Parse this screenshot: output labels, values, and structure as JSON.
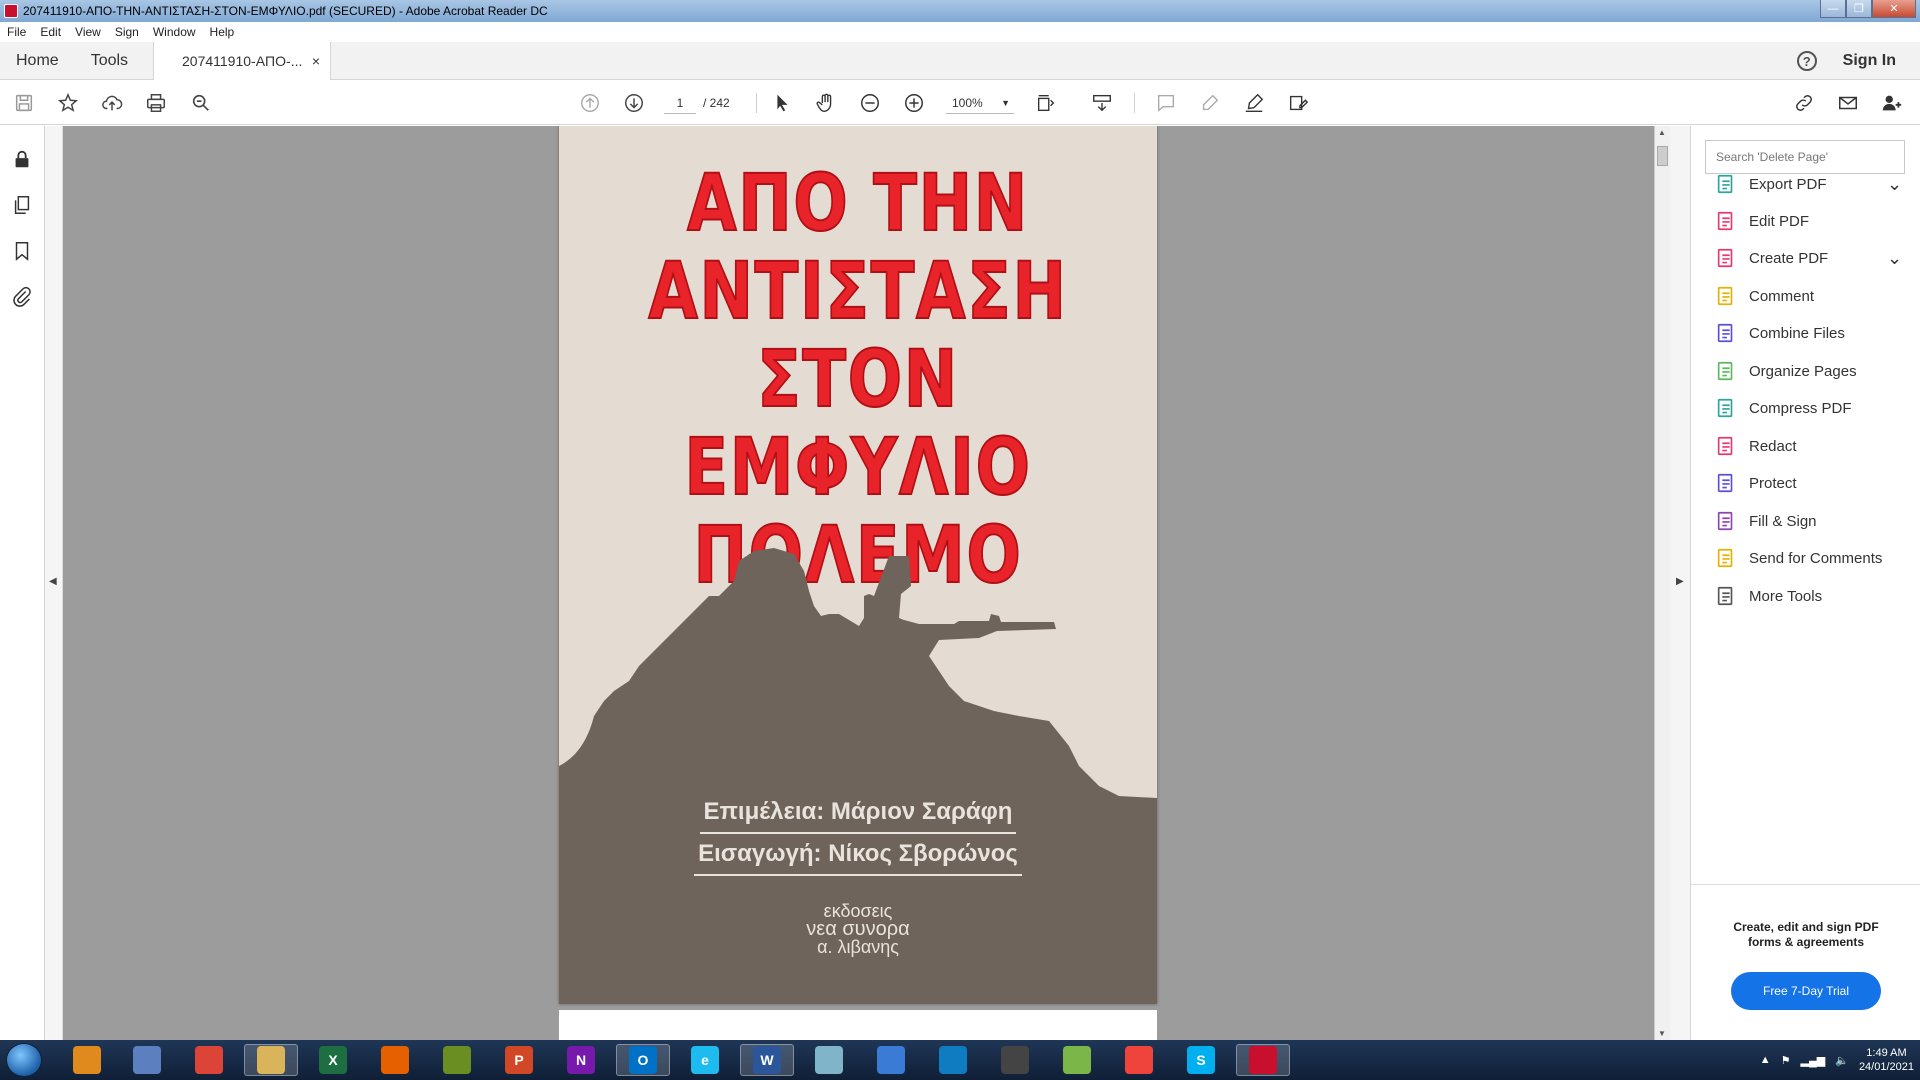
{
  "window": {
    "title": "207411910-ΑΠΟ-ΤΗΝ-ΑΝΤΙΣΤΑΣΗ-ΣΤΟΝ-ΕΜΦΥΛΙΟ.pdf (SECURED) - Adobe Acrobat Reader DC",
    "minimize": "—",
    "maximize": "❐",
    "close": "✕"
  },
  "menubar": [
    "File",
    "Edit",
    "View",
    "Sign",
    "Window",
    "Help"
  ],
  "tabs": {
    "home": "Home",
    "tools": "Tools",
    "document": "207411910-ΑΠΟ-...",
    "close": "×",
    "help": "?",
    "sign_in": "Sign In"
  },
  "toolbar": {
    "current_page": "1",
    "page_count": "/ 242",
    "zoom": "100%"
  },
  "document": {
    "cover_title": [
      "ΑΠΟ ΤΗΝ",
      "ΑΝΤΙΣΤΑΣΗ",
      "ΣΤΟΝ ΕΜΦΥΛΙΟ",
      "ΠΟΛΕΜΟ"
    ],
    "editor": "Επιμέλεια: Μάριον Σαράφη",
    "introduction": "Εισαγωγή: Νίκος Σβορώνος",
    "publisher": [
      "εκδοσεις",
      "νεα συνορα",
      "α. λιβανης"
    ],
    "cover_colors": {
      "title": "#e8232a",
      "silhouette": "#6e645b",
      "paper": "#e4dcd2"
    }
  },
  "right_pane": {
    "search_placeholder": "Search 'Delete Page'",
    "tools": [
      {
        "label": "Export PDF",
        "icon": "export-pdf-icon",
        "color": "#2aa39b",
        "expand": true
      },
      {
        "label": "Edit PDF",
        "icon": "edit-pdf-icon",
        "color": "#e5396e",
        "expand": false
      },
      {
        "label": "Create PDF",
        "icon": "create-pdf-icon",
        "color": "#e5396e",
        "expand": true
      },
      {
        "label": "Comment",
        "icon": "comment-icon",
        "color": "#e6b100",
        "expand": false
      },
      {
        "label": "Combine Files",
        "icon": "combine-files-icon",
        "color": "#5b4fd9",
        "expand": false
      },
      {
        "label": "Organize Pages",
        "icon": "organize-pages-icon",
        "color": "#5cb85c",
        "expand": false
      },
      {
        "label": "Compress PDF",
        "icon": "compress-pdf-icon",
        "color": "#2aa39b",
        "expand": false
      },
      {
        "label": "Redact",
        "icon": "redact-icon",
        "color": "#e5396e",
        "expand": false
      },
      {
        "label": "Protect",
        "icon": "protect-icon",
        "color": "#5b4fd9",
        "expand": false
      },
      {
        "label": "Fill & Sign",
        "icon": "fill-sign-icon",
        "color": "#8e44ad",
        "expand": false
      },
      {
        "label": "Send for Comments",
        "icon": "send-for-comments-icon",
        "color": "#e6b100",
        "expand": false
      },
      {
        "label": "More Tools",
        "icon": "more-tools-icon",
        "color": "#555555",
        "expand": false
      }
    ],
    "promo": "Create, edit and sign PDF forms & agreements",
    "trial_button": "Free 7-Day Trial",
    "accent": "#1473e6"
  },
  "taskbar": {
    "apps": [
      {
        "name": "media-player",
        "label": "",
        "color": "#e08a1e"
      },
      {
        "name": "photo-app",
        "label": "",
        "color": "#5b7fbf"
      },
      {
        "name": "chrome",
        "label": "",
        "color": "#db4437"
      },
      {
        "name": "file-explorer",
        "label": "",
        "color": "#d9b45a"
      },
      {
        "name": "excel",
        "label": "X",
        "color": "#1d6f42"
      },
      {
        "name": "firefox",
        "label": "",
        "color": "#e66000"
      },
      {
        "name": "paint",
        "label": "",
        "color": "#6b8e23"
      },
      {
        "name": "powerpoint",
        "label": "P",
        "color": "#d24726"
      },
      {
        "name": "onenote",
        "label": "N",
        "color": "#7719aa"
      },
      {
        "name": "outlook",
        "label": "O",
        "color": "#0072c6"
      },
      {
        "name": "internet-explorer",
        "label": "e",
        "color": "#1ebbee"
      },
      {
        "name": "word",
        "label": "W",
        "color": "#2b579a"
      },
      {
        "name": "notes",
        "label": "",
        "color": "#7fb4c9"
      },
      {
        "name": "paint-net",
        "label": "",
        "color": "#3a7bd5"
      },
      {
        "name": "edge",
        "label": "",
        "color": "#0f7cc2"
      },
      {
        "name": "pen-tool",
        "label": "",
        "color": "#444444"
      },
      {
        "name": "chart-app",
        "label": "",
        "color": "#7ab648"
      },
      {
        "name": "anydesk",
        "label": "",
        "color": "#ef443b"
      },
      {
        "name": "skype",
        "label": "S",
        "color": "#00aff0"
      },
      {
        "name": "acrobat",
        "label": "",
        "color": "#c8102e"
      }
    ],
    "time": "1:49 AM",
    "date": "24/01/2021"
  }
}
